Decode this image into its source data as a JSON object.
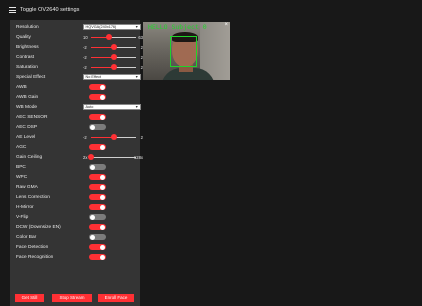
{
  "header": {
    "title": "Toggle OV2640 settings"
  },
  "settings": {
    "resolution": {
      "label": "Resolution",
      "value": "HQVGA(240x176)"
    },
    "quality": {
      "label": "Quality",
      "min": "10",
      "max": "63",
      "value": 0.4
    },
    "brightness": {
      "label": "Brightness",
      "min": "-2",
      "max": "2",
      "value": 0.5
    },
    "contrast": {
      "label": "Contrast",
      "min": "-2",
      "max": "2",
      "value": 0.5
    },
    "saturation": {
      "label": "Saturation",
      "min": "-2",
      "max": "2",
      "value": 0.5
    },
    "special_effect": {
      "label": "Special Effect",
      "value": "No Effect"
    },
    "awb": {
      "label": "AWB",
      "on": true
    },
    "awb_gain": {
      "label": "AWB Gain",
      "on": true
    },
    "wb_mode": {
      "label": "WB Mode",
      "value": "Auto"
    },
    "aec_sensor": {
      "label": "AEC SENSOR",
      "on": true
    },
    "aec_dsp": {
      "label": "AEC DSP",
      "on": false
    },
    "ae_level": {
      "label": "AE Level",
      "min": "-2",
      "max": "2",
      "value": 0.5
    },
    "agc": {
      "label": "AGC",
      "on": true
    },
    "gain_ceiling": {
      "label": "Gain Ceiling",
      "min": "2x",
      "max": "128x",
      "value": 0.0
    },
    "bpc": {
      "label": "BPC",
      "on": false
    },
    "wpc": {
      "label": "WPC",
      "on": true
    },
    "raw_gma": {
      "label": "Raw GMA",
      "on": true
    },
    "lens_correction": {
      "label": "Lens Correction",
      "on": true
    },
    "h_mirror": {
      "label": "H-Mirror",
      "on": true
    },
    "v_flip": {
      "label": "V-Flip",
      "on": false
    },
    "dcw": {
      "label": "DCW (Downsize EN)",
      "on": true
    },
    "color_bar": {
      "label": "Color Bar",
      "on": false
    },
    "face_detection": {
      "label": "Face Detection",
      "on": true
    },
    "face_recognition": {
      "label": "Face Recognition",
      "on": true
    }
  },
  "buttons": {
    "get_still": "Get Still",
    "stop_stream": "Stop Stream",
    "enroll_face": "Enroll Face"
  },
  "stream": {
    "overlay_text": "HELLO Subject 0",
    "close": "×"
  },
  "colors": {
    "accent": "#ff3034",
    "panel": "#343434",
    "background": "#181818",
    "detection_box": "#1fd32a"
  }
}
